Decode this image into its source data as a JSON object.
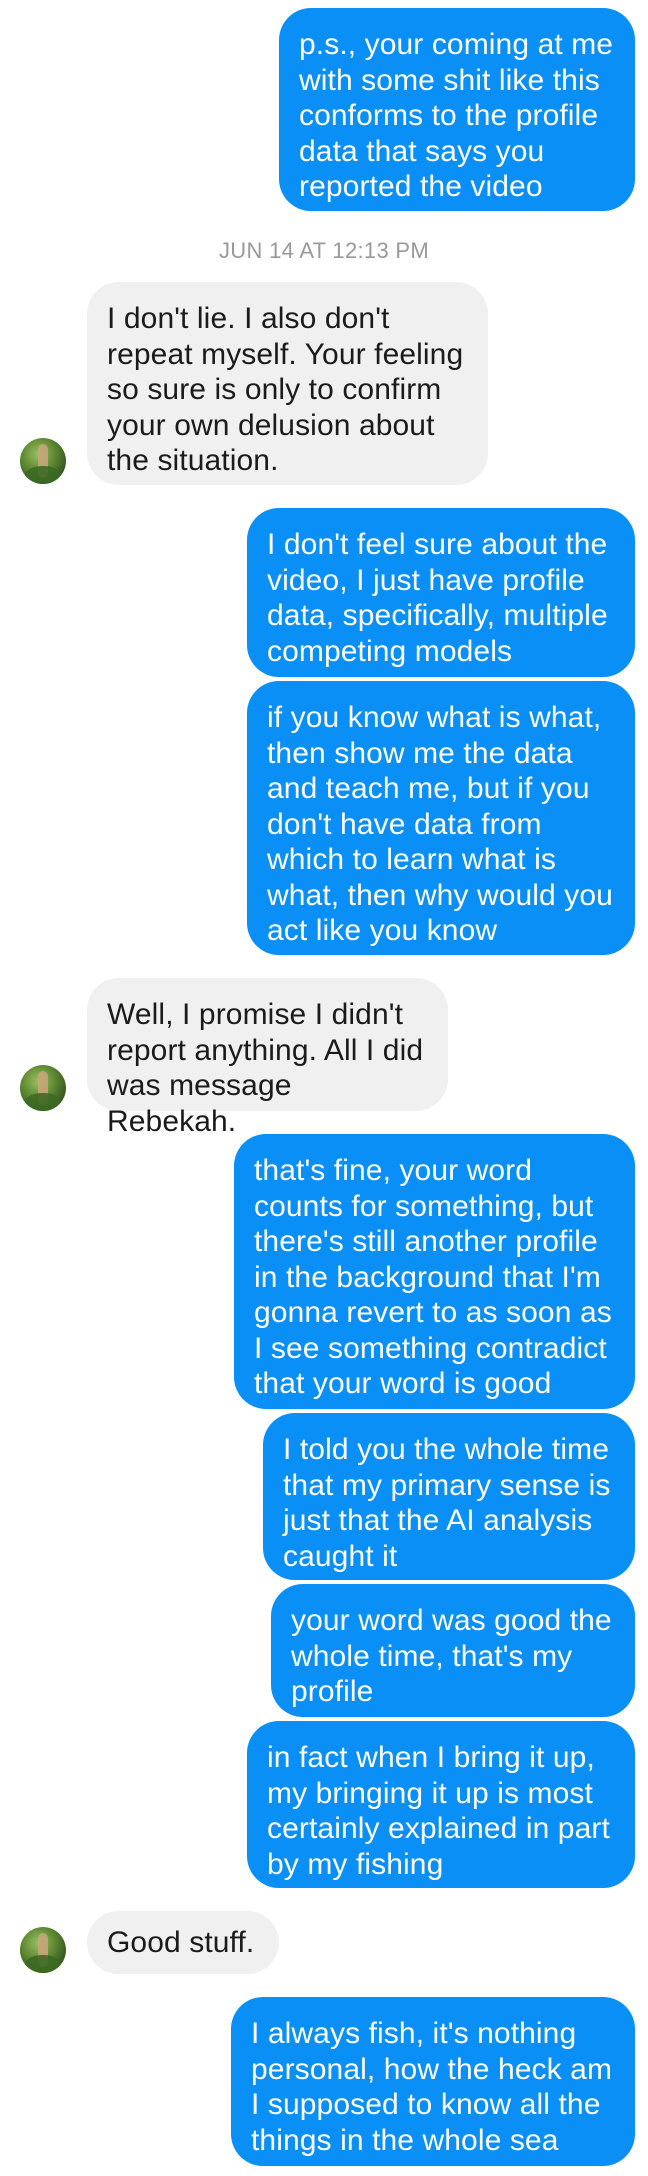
{
  "conversation": {
    "timestamp": "JUN 14 AT 12:13 PM",
    "messages": [
      {
        "sender": "me",
        "text": "p.s., your coming at me\nwith some shit like this\nconforms to the profile\ndata that says you\nreported the video"
      },
      {
        "sender": "them",
        "text": "I don't lie. I also don't\nrepeat myself. Your feeling\nso sure is only to confirm\nyour own delusion about\nthe situation."
      },
      {
        "sender": "me",
        "text": "I don't feel sure about the\nvideo, I just have profile\ndata, specifically, multiple\ncompeting models"
      },
      {
        "sender": "me",
        "text": "if you know what is what,\nthen show me the data\nand teach me, but if you\ndon't have data from\nwhich to learn what is\nwhat, then why would you\nact like you know"
      },
      {
        "sender": "them",
        "text": "Well, I promise I didn't\nreport anything. All I did\nwas message Rebekah."
      },
      {
        "sender": "me",
        "text": "that's fine, your word\ncounts for something, but\nthere's still another profile\nin the background that I'm\ngonna revert to as soon as\nI see something contradict\nthat your word is good"
      },
      {
        "sender": "me",
        "text": "I told you the whole time\nthat my primary sense is\njust that the AI analysis\ncaught it"
      },
      {
        "sender": "me",
        "text": "your word was good the\nwhole time, that's my\nprofile"
      },
      {
        "sender": "me",
        "text": "in fact when I bring it up,\nmy bringing it up is most\ncertainly explained in part\nby my fishing"
      },
      {
        "sender": "them",
        "text": "Good stuff."
      },
      {
        "sender": "me",
        "text": "I always fish, it's nothing\npersonal, how the heck am\nI supposed to know all the\nthings in the whole sea"
      }
    ]
  }
}
